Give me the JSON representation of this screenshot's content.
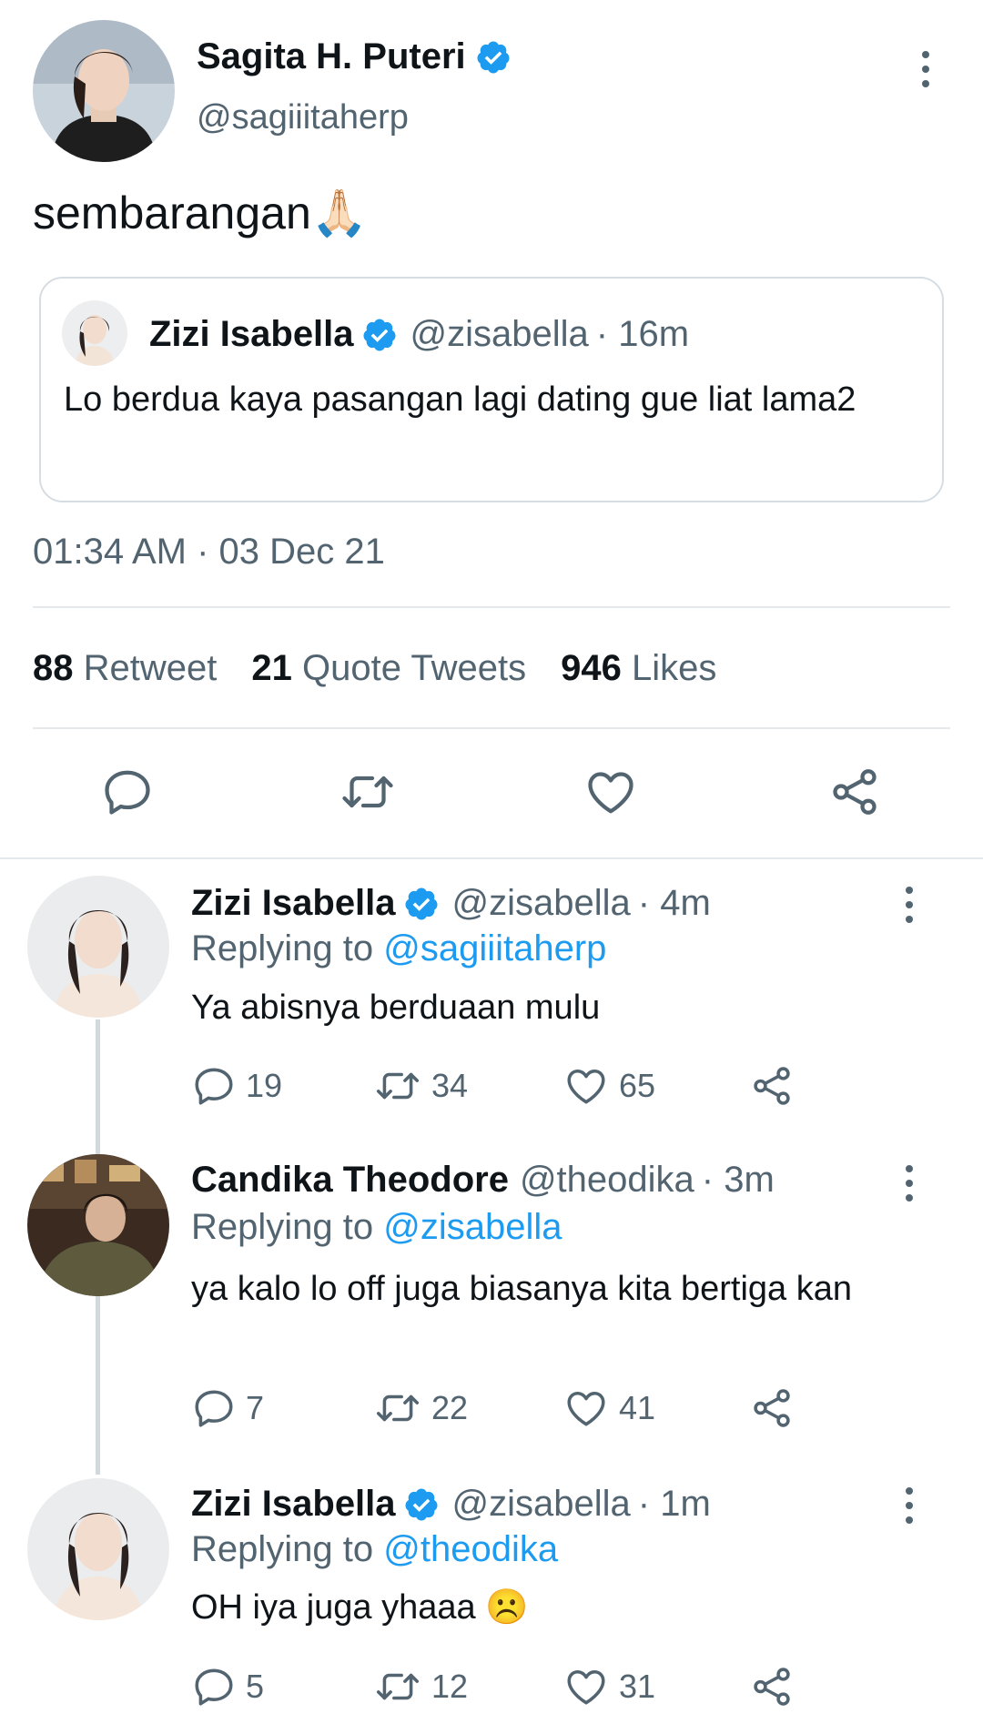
{
  "main_tweet": {
    "author_name": "Sagita H. Puteri",
    "author_handle": "@sagiiitaherp",
    "text": "sembarangan",
    "emoji": "🙏🏻",
    "timestamp": "01:34 AM · 03 Dec 21",
    "quoted": {
      "author_name": "Zizi Isabella",
      "author_handle": "@zisabella",
      "time": "· 16m",
      "text": "Lo berdua kaya pasangan lagi dating gue liat lama2"
    },
    "stats": {
      "retweets_count": "88",
      "retweets_label": "Retweet",
      "quotes_count": "21",
      "quotes_label": "Quote Tweets",
      "likes_count": "946",
      "likes_label": "Likes"
    },
    "actions": [
      "reply-icon",
      "retweet-icon",
      "like-icon",
      "share-icon"
    ]
  },
  "replies": [
    {
      "author_name": "Zizi Isabella",
      "author_handle": "@zisabella",
      "time": "· 4m",
      "replying_prefix": "Replying to",
      "replying_to": "@sagiiitaherp",
      "text": "Ya abisnya berduaan mulu",
      "reply_count": "19",
      "retweet_count": "34",
      "like_count": "65"
    },
    {
      "author_name": "Candika Theodore",
      "author_handle": "@theodika",
      "time": "· 3m",
      "replying_prefix": "Replying to",
      "replying_to": "@zisabella",
      "text": "ya kalo lo off juga biasanya kita bertiga kan",
      "reply_count": "7",
      "retweet_count": "22",
      "like_count": "41"
    },
    {
      "author_name": "Zizi Isabella",
      "author_handle": "@zisabella",
      "time": "· 1m",
      "replying_prefix": "Replying to",
      "replying_to": "@theodika",
      "text": "OH iya juga yhaaa",
      "emoji": "☹️",
      "reply_count": "5",
      "retweet_count": "12",
      "like_count": "31"
    }
  ],
  "colors": {
    "accent": "#1d9bf0",
    "muted": "#536471",
    "divider": "#e6e9ec",
    "text": "#0f1419"
  }
}
